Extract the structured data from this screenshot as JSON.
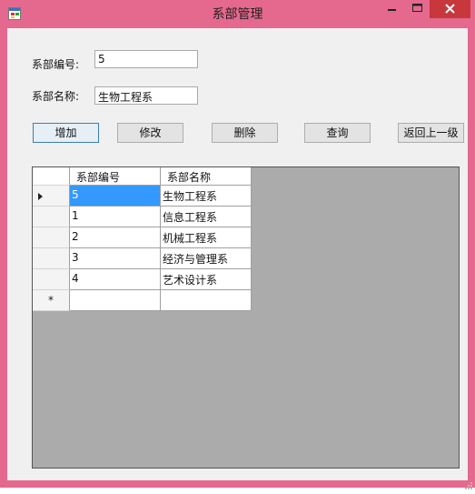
{
  "window": {
    "title": "系部管理",
    "icon": "app-form-icon",
    "close_color": "#c7373b",
    "frame_color": "#e5688f"
  },
  "form": {
    "id_label": "系部编号:",
    "id_value": "5",
    "name_label": "系部名称:",
    "name_value": "生物工程系"
  },
  "buttons": {
    "add": "增加",
    "edit": "修改",
    "delete": "删除",
    "query": "查询",
    "back": "返回上一级"
  },
  "grid": {
    "columns": [
      "系部编号",
      "系部名称"
    ],
    "rows": [
      [
        "5",
        "生物工程系"
      ],
      [
        "1",
        "信息工程系"
      ],
      [
        "2",
        "机械工程系"
      ],
      [
        "3",
        "经济与管理系"
      ],
      [
        "4",
        "艺术设计系"
      ]
    ],
    "new_row_marker": "*",
    "current_row_marker": "row-pointer-icon"
  }
}
